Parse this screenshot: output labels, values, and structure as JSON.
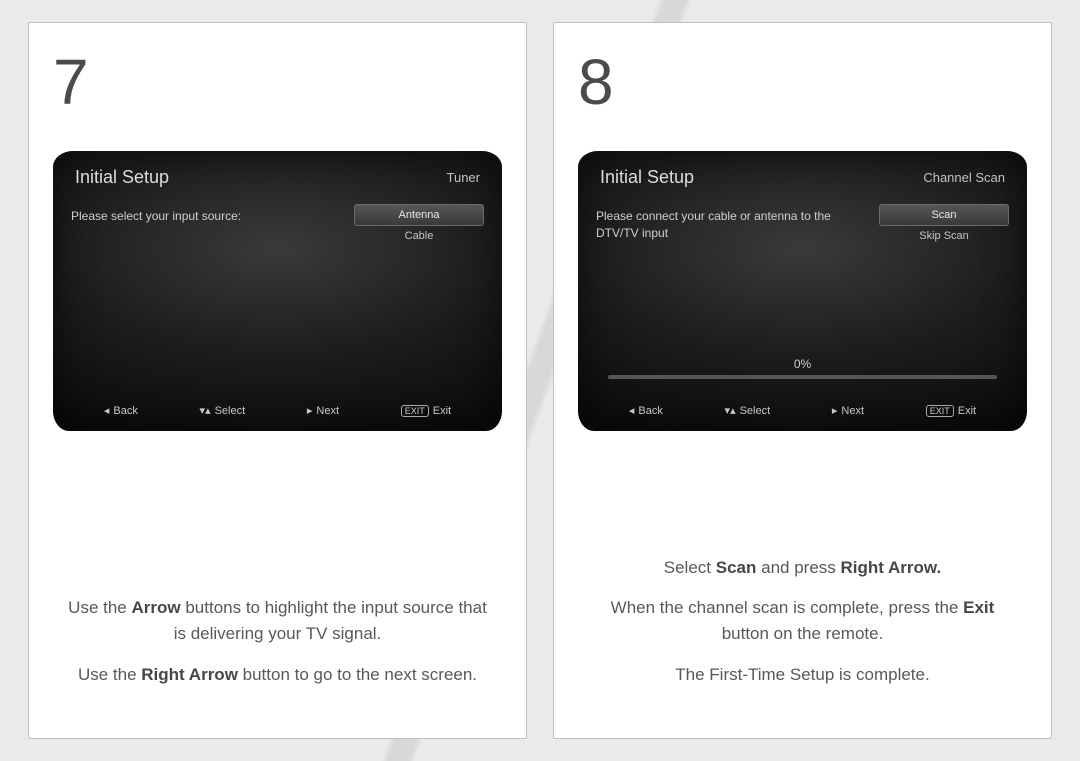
{
  "step7": {
    "number": "7",
    "tv": {
      "title": "Initial Setup",
      "subtitle": "Tuner",
      "prompt": "Please select your input source:",
      "options": [
        "Antenna",
        "Cable"
      ],
      "footer": {
        "back": "Back",
        "select": "Select",
        "next": "Next",
        "exit_box": "EXIT",
        "exit": "Exit"
      }
    },
    "instruction_html": "Use the <b>Arrow</b> buttons to highlight the input source that is delivering your TV signal.<br><br>Use the <b>Right Arrow</b> button to go to the next screen."
  },
  "step8": {
    "number": "8",
    "tv": {
      "title": "Initial Setup",
      "subtitle": "Channel Scan",
      "prompt": "Please connect your cable or antenna to the DTV/TV input",
      "options": [
        "Scan",
        "Skip Scan"
      ],
      "progress": "0%",
      "footer": {
        "back": "Back",
        "select": "Select",
        "next": "Next",
        "exit_box": "EXIT",
        "exit": "Exit"
      }
    },
    "instruction_html": "Select <b>Scan</b> and press <b>Right Arrow.</b><br><br>When the channel scan is complete, press the <b>Exit</b> button on the remote.<br><br>The First-Time Setup is complete."
  }
}
